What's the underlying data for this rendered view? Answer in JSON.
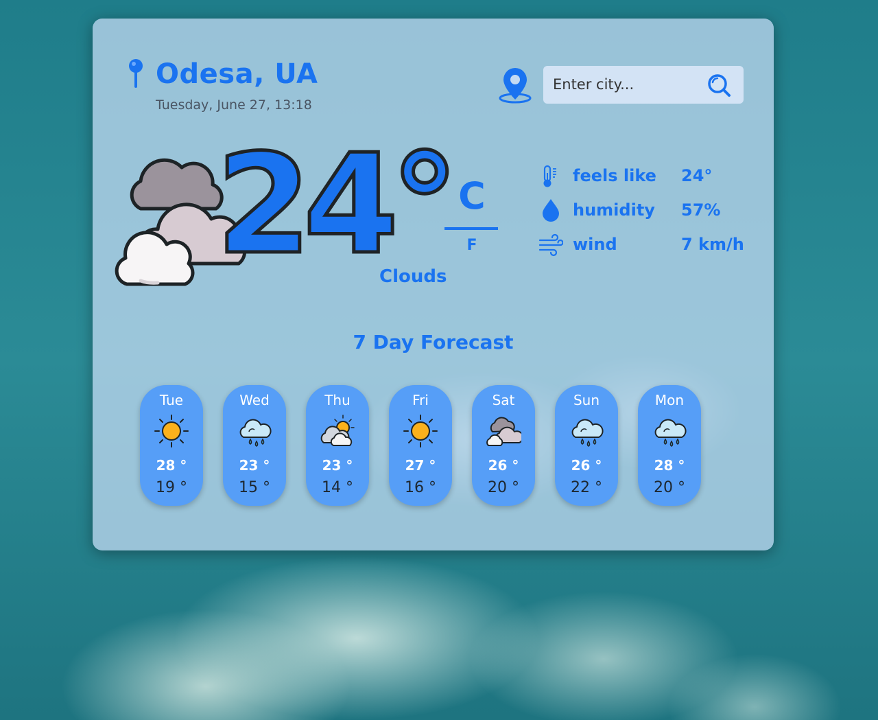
{
  "location": {
    "city": "Odesa, UA",
    "datetime": "Tuesday, June 27, 13:18"
  },
  "search": {
    "placeholder": "Enter city..."
  },
  "current": {
    "temperature": "24°",
    "condition": "Clouds",
    "condition_icon": "clouds-icon",
    "units": {
      "celsius": "C",
      "fahrenheit": "F",
      "active": "C"
    }
  },
  "stats": {
    "feels_like": {
      "label": "feels like",
      "value": "24°",
      "icon": "thermometer-icon"
    },
    "humidity": {
      "label": "humidity",
      "value": "57%",
      "icon": "droplet-icon"
    },
    "wind": {
      "label": "wind",
      "value": "7 km/h",
      "icon": "wind-icon"
    }
  },
  "forecast": {
    "title": "7 Day Forecast",
    "days": [
      {
        "day": "Tue",
        "high": "28 °",
        "low": "19 °",
        "icon": "sun-icon"
      },
      {
        "day": "Wed",
        "high": "23 °",
        "low": "15 °",
        "icon": "rain-cloud-icon"
      },
      {
        "day": "Thu",
        "high": "23 °",
        "low": "14 °",
        "icon": "partly-cloudy-icon"
      },
      {
        "day": "Fri",
        "high": "27 °",
        "low": "16 °",
        "icon": "sun-icon"
      },
      {
        "day": "Sat",
        "high": "26 °",
        "low": "20 °",
        "icon": "clouds-icon"
      },
      {
        "day": "Sun",
        "high": "26 °",
        "low": "22 °",
        "icon": "rain-cloud-icon"
      },
      {
        "day": "Mon",
        "high": "28 °",
        "low": "20 °",
        "icon": "rain-cloud-icon"
      }
    ]
  },
  "colors": {
    "accent": "#1a73f0",
    "card": "#c4dbf3",
    "day_card": "#569ef7",
    "sun": "#fbb11c"
  }
}
